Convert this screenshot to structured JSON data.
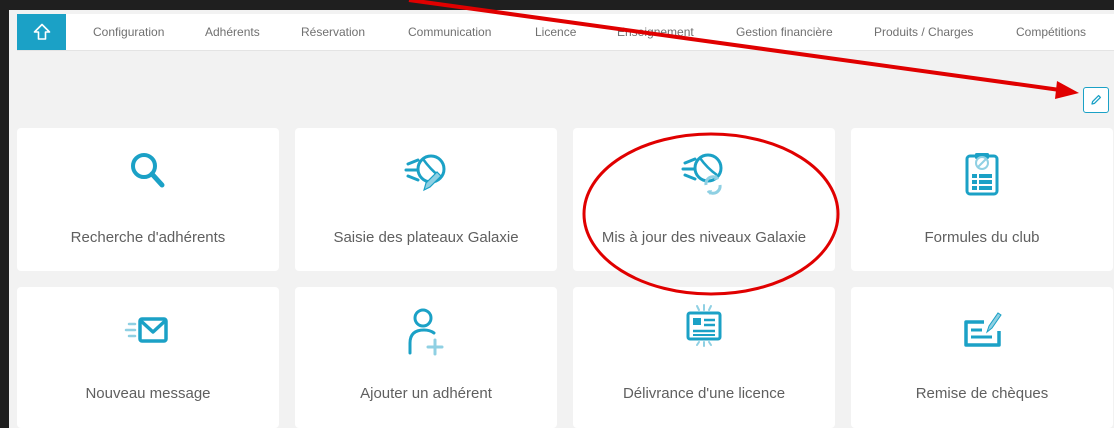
{
  "nav": {
    "items": [
      "Configuration",
      "Adhérents",
      "Réservation",
      "Communication",
      "Licence",
      "Enseignement",
      "Gestion financière",
      "Produits / Charges",
      "Compétitions"
    ]
  },
  "tiles": [
    {
      "label": "Recherche d'adhérents",
      "icon": "search-icon"
    },
    {
      "label": "Saisie des plateaux Galaxie",
      "icon": "tennis-ball-pencil-icon"
    },
    {
      "label": "Mis à jour des niveaux Galaxie",
      "icon": "tennis-ball-refresh-icon"
    },
    {
      "label": "Formules du club",
      "icon": "clipboard-ball-icon"
    },
    {
      "label": "Nouveau message",
      "icon": "send-mail-icon"
    },
    {
      "label": "Ajouter un adhérent",
      "icon": "add-user-icon"
    },
    {
      "label": "Délivrance d'une licence",
      "icon": "license-card-icon"
    },
    {
      "label": "Remise de chèques",
      "icon": "cheque-icon"
    }
  ],
  "colors": {
    "accent": "#1ba1c6",
    "annotation": "#e00000"
  }
}
